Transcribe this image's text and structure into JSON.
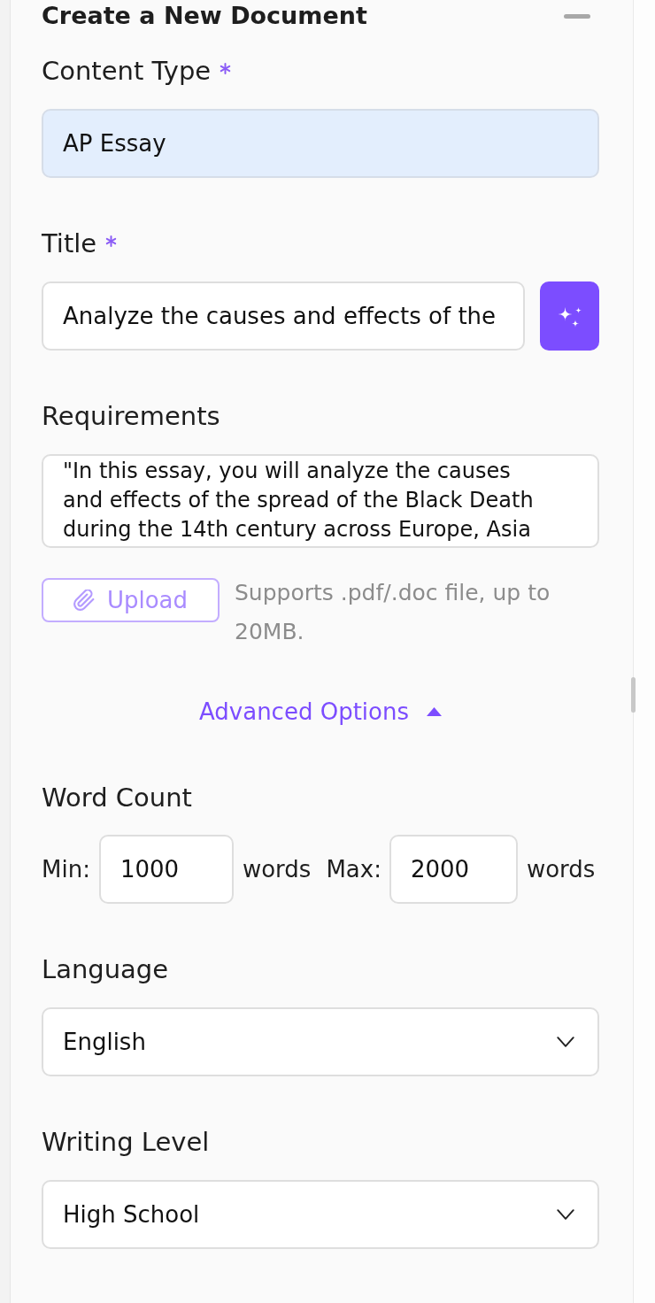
{
  "header": {
    "title": "Create a New Document"
  },
  "content_type": {
    "label": "Content Type",
    "required": true,
    "value": "AP Essay"
  },
  "title": {
    "label": "Title",
    "required": true,
    "value": "Analyze the causes and effects of the"
  },
  "requirements": {
    "label": "Requirements",
    "value": "\"In this essay, you will analyze the causes and effects of the spread of the Black Death during the 14th century across Europe, Asia",
    "upload_button": "Upload",
    "upload_hint": "Supports .pdf/.doc file, up to 20MB."
  },
  "advanced_options": {
    "label": "Advanced Options",
    "expanded": true
  },
  "word_count": {
    "label": "Word Count",
    "min_label": "Min:",
    "min_value": "1000",
    "min_unit": "words",
    "max_label": "Max:",
    "max_value": "2000",
    "max_unit": "words"
  },
  "language": {
    "label": "Language",
    "value": "English"
  },
  "writing_level": {
    "label": "Writing Level",
    "value": "High School"
  }
}
